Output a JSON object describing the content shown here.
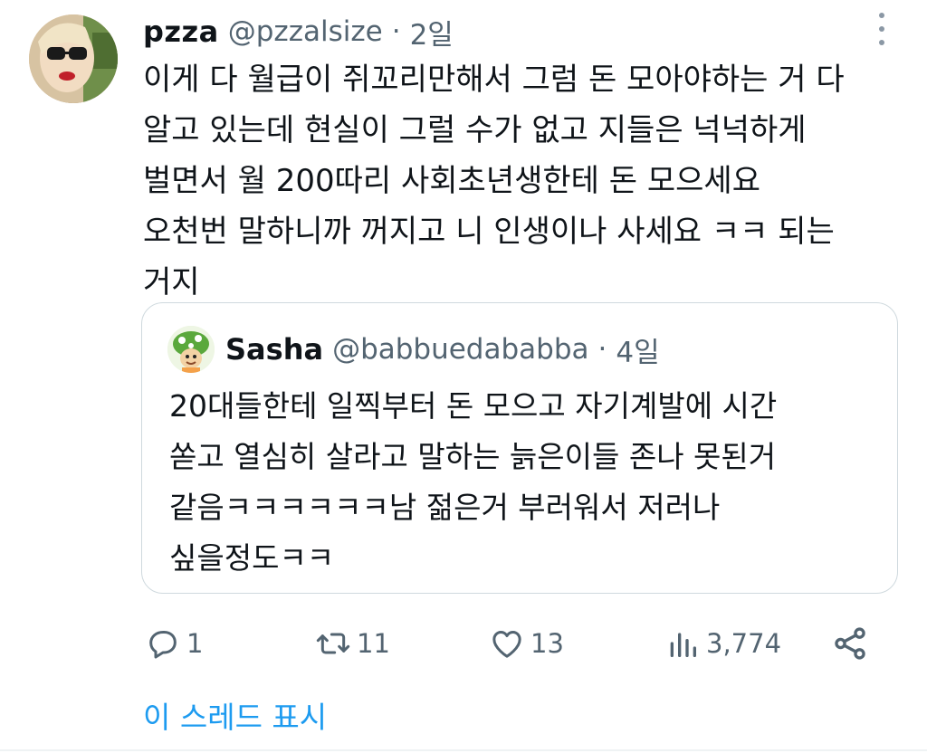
{
  "tweet": {
    "display_name": "pzza",
    "handle": "@pzzalsize",
    "separator": "·",
    "time": "2일",
    "body_lines": [
      "이게 다 월급이 쥐꼬리만해서 그럼 돈 모아야하는 거 다",
      "알고 있는데 현실이 그럴 수가 없고 지들은 넉넉하게",
      "벌면서 월 200따리 사회초년생한테 돈 모으세요",
      "오천번 말하니까 꺼지고 니 인생이나 사세요 ㅋㅋ 되는",
      "거지"
    ]
  },
  "quote": {
    "display_name": "Sasha",
    "handle": "@babbuedababba",
    "separator": "·",
    "time": "4일",
    "body_lines": [
      "20대들한테 일찍부터 돈 모으고 자기계발에 시간",
      "쏟고 열심히 살라고 말하는 늙은이들 존나 못된거",
      "같음ㅋㅋㅋㅋㅋㅋ남 젊은거 부러워서 저러나",
      "싶을정도ㅋㅋ"
    ]
  },
  "actions": {
    "reply_count": "1",
    "retweet_count": "11",
    "like_count": "13",
    "view_count": "3,774"
  },
  "show_thread_label": "이 스레드 표시",
  "icons": {
    "more": "more-vertical-icon",
    "reply": "reply-icon",
    "retweet": "retweet-icon",
    "like": "heart-icon",
    "views": "views-icon",
    "share": "share-icon"
  },
  "colors": {
    "text": "#0f1419",
    "secondary": "#536471",
    "link": "#1d9bf0",
    "border": "#cfd9de"
  }
}
